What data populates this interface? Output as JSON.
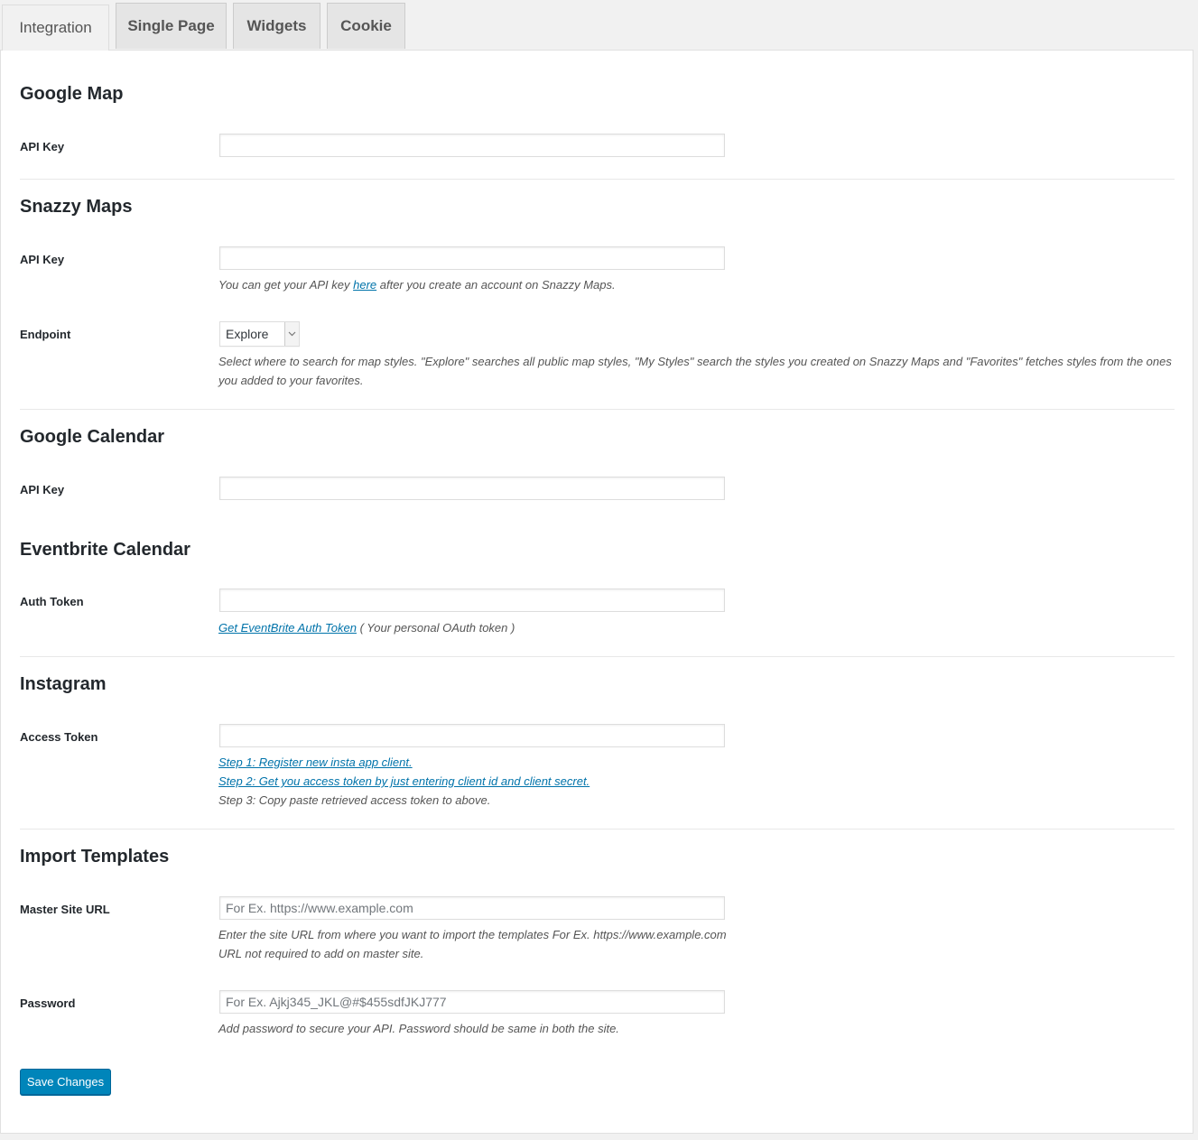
{
  "tabs": [
    {
      "label": "Integration",
      "active": true
    },
    {
      "label": "Single Page",
      "active": false
    },
    {
      "label": "Widgets",
      "active": false
    },
    {
      "label": "Cookie",
      "active": false
    }
  ],
  "google_map": {
    "title": "Google Map",
    "api_key_label": "API Key",
    "api_key_value": ""
  },
  "snazzy_maps": {
    "title": "Snazzy Maps",
    "api_key_label": "API Key",
    "api_key_value": "",
    "api_key_desc_before": "You can get your API key ",
    "api_key_desc_link": "here",
    "api_key_desc_after": " after you create an account on Snazzy Maps.",
    "endpoint_label": "Endpoint",
    "endpoint_value": "Explore",
    "endpoint_desc": "Select where to search for map styles. \"Explore\" searches all public map styles, \"My Styles\" search the styles you created on Snazzy Maps and \"Favorites\" fetches styles from the ones you added to your favorites."
  },
  "google_calendar": {
    "title": "Google Calendar",
    "api_key_label": "API Key",
    "api_key_value": ""
  },
  "eventbrite": {
    "title": "Eventbrite Calendar",
    "token_label": "Auth Token",
    "token_value": "",
    "desc_link": "Get EventBrite Auth Token",
    "desc_after": " ( Your personal OAuth token )"
  },
  "instagram": {
    "title": "Instagram",
    "token_label": "Access Token",
    "token_value": "",
    "step1": "Step 1: Register new insta app client.",
    "step2": "Step 2: Get you access token by just entering client id and client secret.",
    "step3": "Step 3: Copy paste retrieved access token to above."
  },
  "import_templates": {
    "title": "Import Templates",
    "url_label": "Master Site URL",
    "url_placeholder": "For Ex. https://www.example.com",
    "url_desc_line1": "Enter the site URL from where you want to import the templates For Ex. https://www.example.com",
    "url_desc_line2": "URL not required to add on master site.",
    "password_label": "Password",
    "password_placeholder": "For Ex. Ajkj345_JKL@#$455sdfJKJ777",
    "password_desc": "Add password to secure your API. Password should be same in both the site."
  },
  "save_button": "Save Changes",
  "colors": {
    "primary_button": "#0085ba",
    "link": "#0073aa"
  }
}
